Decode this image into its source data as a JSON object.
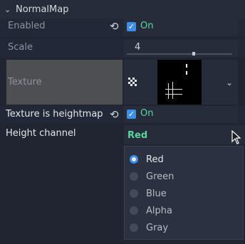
{
  "section": {
    "title": "NormalMap",
    "collapse_icon": "chevron-down-icon"
  },
  "properties": {
    "enabled": {
      "label": "Enabled",
      "checked": true,
      "value_text": "On",
      "revert_icon": "revert-icon"
    },
    "scale": {
      "label": "Scale",
      "value": "4",
      "slider_fraction": 0.75
    },
    "texture": {
      "label": "Texture",
      "resource_icon": "texture-resource-icon",
      "menu_icon": "chevron-down-icon"
    },
    "texture_is_heightmap": {
      "label": "Texture is heightmap",
      "checked": true,
      "value_text": "On",
      "revert_icon": "revert-icon"
    },
    "height_channel": {
      "label": "Height channel",
      "selected": "Red"
    }
  },
  "channel_popup": {
    "options": [
      "Red",
      "Green",
      "Blue",
      "Alpha",
      "Gray"
    ],
    "selected_index": 0
  },
  "colors": {
    "accent": "#3d8fe6",
    "on_text": "#59d7a0",
    "background": "#202531"
  }
}
